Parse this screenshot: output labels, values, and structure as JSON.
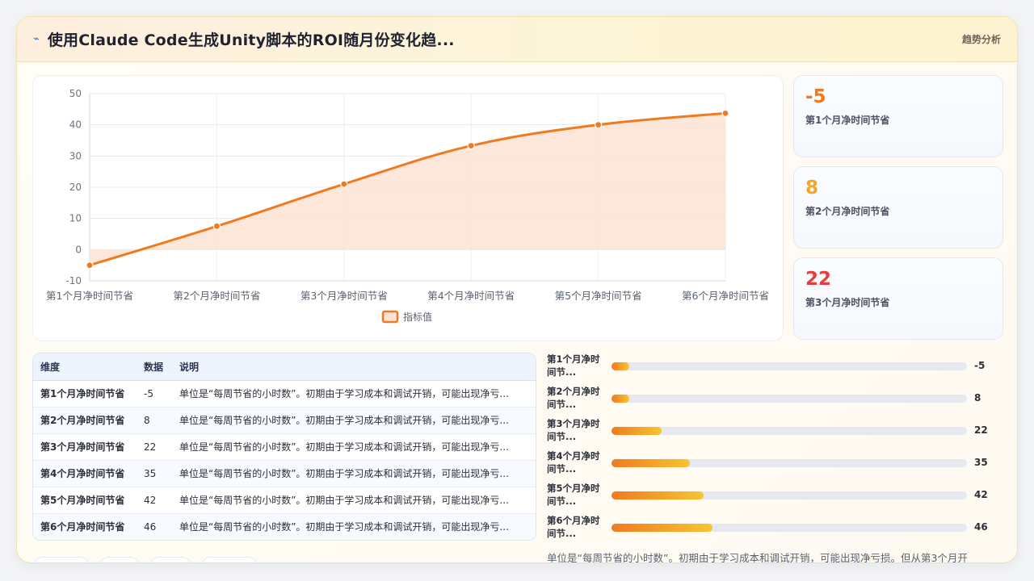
{
  "header": {
    "icon": "bolt-icon",
    "title": "使用Claude Code生成Unity脚本的ROI随月份变化趋...",
    "tag": "趋势分析"
  },
  "colors": {
    "accent": "#f07a1f",
    "area_fill": "#fbe3d4",
    "stat_1": "#f07a1f",
    "stat_2": "#f5a623",
    "stat_3": "#e53e3e"
  },
  "chart_data": {
    "type": "line",
    "categories": [
      "第1个月净时间节省",
      "第2个月净时间节省",
      "第3个月净时间节省",
      "第4个月净时间节省",
      "第5个月净时间节省",
      "第6个月净时间节省"
    ],
    "series": [
      {
        "name": "指标值",
        "values": [
          -5,
          7.5,
          21,
          33.3,
          40,
          43.7
        ]
      }
    ],
    "ylim": [
      -10,
      50
    ],
    "yticks": [
      50,
      40,
      30,
      20,
      10,
      0,
      -10
    ],
    "grid": true,
    "fill": true,
    "smooth": true,
    "legend": "bottom"
  },
  "stats": [
    {
      "value": "-5",
      "label": "第1个月净时间节省"
    },
    {
      "value": "8",
      "label": "第2个月净时间节省"
    },
    {
      "value": "22",
      "label": "第3个月净时间节省"
    }
  ],
  "table": {
    "headers": [
      "维度",
      "数据",
      "说明"
    ],
    "rows": [
      [
        "第1个月净时间节省",
        "-5",
        "单位是“每周节省的小时数”。初期由于学习成本和调试开销，可能出现净亏..."
      ],
      [
        "第2个月净时间节省",
        "8",
        "单位是“每周节省的小时数”。初期由于学习成本和调试开销，可能出现净亏..."
      ],
      [
        "第3个月净时间节省",
        "22",
        "单位是“每周节省的小时数”。初期由于学习成本和调试开销，可能出现净亏..."
      ],
      [
        "第4个月净时间节省",
        "35",
        "单位是“每周节省的小时数”。初期由于学习成本和调试开销，可能出现净亏..."
      ],
      [
        "第5个月净时间节省",
        "42",
        "单位是“每周节省的小时数”。初期由于学习成本和调试开销，可能出现净亏..."
      ],
      [
        "第6个月净时间节省",
        "46",
        "单位是“每周节省的小时数”。初期由于学习成本和调试开销，可能出现净亏..."
      ]
    ]
  },
  "bars": [
    {
      "label": "第1个月净时\n间节...",
      "value": "-5",
      "fill": 0.05
    },
    {
      "label": "第2个月净时\n间节...",
      "value": "8",
      "fill": 0.05
    },
    {
      "label": "第3个月净时\n间节...",
      "value": "22",
      "fill": 0.14
    },
    {
      "label": "第4个月净时\n间节...",
      "value": "35",
      "fill": 0.22
    },
    {
      "label": "第5个月净时\n间节...",
      "value": "42",
      "fill": 0.26
    },
    {
      "label": "第6个月净时\n间节...",
      "value": "46",
      "fill": 0.285
    }
  ],
  "note": "单位是“每周节省的小时数”。初期由于学习成本和调试开销，可能出现净亏损。但从第3个月开"
}
